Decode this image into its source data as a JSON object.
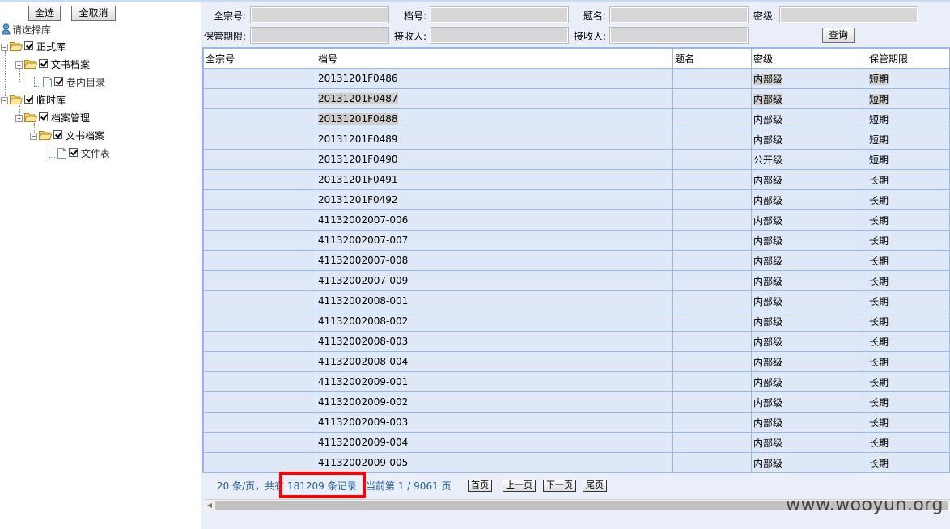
{
  "left": {
    "select_all": "全选",
    "deselect_all": "全取消",
    "root_label": "请选择库",
    "tree": [
      {
        "label": "正式库"
      },
      {
        "label": "文书档案"
      },
      {
        "label": "卷内目录"
      },
      {
        "label": "临时库"
      },
      {
        "label": "档案管理"
      },
      {
        "label": "文书档案"
      },
      {
        "label": "文件表"
      }
    ]
  },
  "query": {
    "fonds_label": "全宗号:",
    "archive_no_label": "档号:",
    "title_label": "题名:",
    "secret_label": "密级:",
    "retention_label": "保管期限:",
    "receiver_label_1": "接收人:",
    "receiver_label_2": "接收人:",
    "search_button": "查询"
  },
  "grid": {
    "columns": [
      "全宗号",
      "档号",
      "题名",
      "密级",
      "保管期限"
    ],
    "rows": [
      [
        "",
        "20131201F0486",
        "",
        "内部级",
        "短期"
      ],
      [
        "",
        "20131201F0487",
        "",
        "内部级",
        "短期"
      ],
      [
        "",
        "20131201F0488",
        "",
        "内部级",
        "短期"
      ],
      [
        "",
        "20131201F0489",
        "",
        "内部级",
        "短期"
      ],
      [
        "",
        "20131201F0490",
        "",
        "公开级",
        "短期"
      ],
      [
        "",
        "20131201F0491",
        "",
        "内部级",
        "长期"
      ],
      [
        "",
        "20131201F0492",
        "",
        "内部级",
        "长期"
      ],
      [
        "",
        "41132002007-006",
        "",
        "内部级",
        "长期"
      ],
      [
        "",
        "41132002007-007",
        "",
        "内部级",
        "长期"
      ],
      [
        "",
        "41132002007-008",
        "",
        "内部级",
        "长期"
      ],
      [
        "",
        "41132002007-009",
        "",
        "内部级",
        "长期"
      ],
      [
        "",
        "41132002008-001",
        "",
        "内部级",
        "长期"
      ],
      [
        "",
        "41132002008-002",
        "",
        "内部级",
        "长期"
      ],
      [
        "",
        "41132002008-003",
        "",
        "内部级",
        "长期"
      ],
      [
        "",
        "41132002008-004",
        "",
        "内部级",
        "长期"
      ],
      [
        "",
        "41132002009-001",
        "",
        "内部级",
        "长期"
      ],
      [
        "",
        "41132002009-002",
        "",
        "内部级",
        "长期"
      ],
      [
        "",
        "41132002009-003",
        "",
        "内部级",
        "长期"
      ],
      [
        "",
        "41132002009-004",
        "",
        "内部级",
        "长期"
      ],
      [
        "",
        "41132002009-005",
        "",
        "内部级",
        "长期"
      ]
    ]
  },
  "pager": {
    "per_page": "20 条/页，共有",
    "total": "181209 条记录",
    "current": "当前第 1 / 9061 页",
    "first": "首页",
    "prev": "上一页",
    "next": "下一页",
    "last": "尾页"
  },
  "watermark": "www.wooyun.org"
}
